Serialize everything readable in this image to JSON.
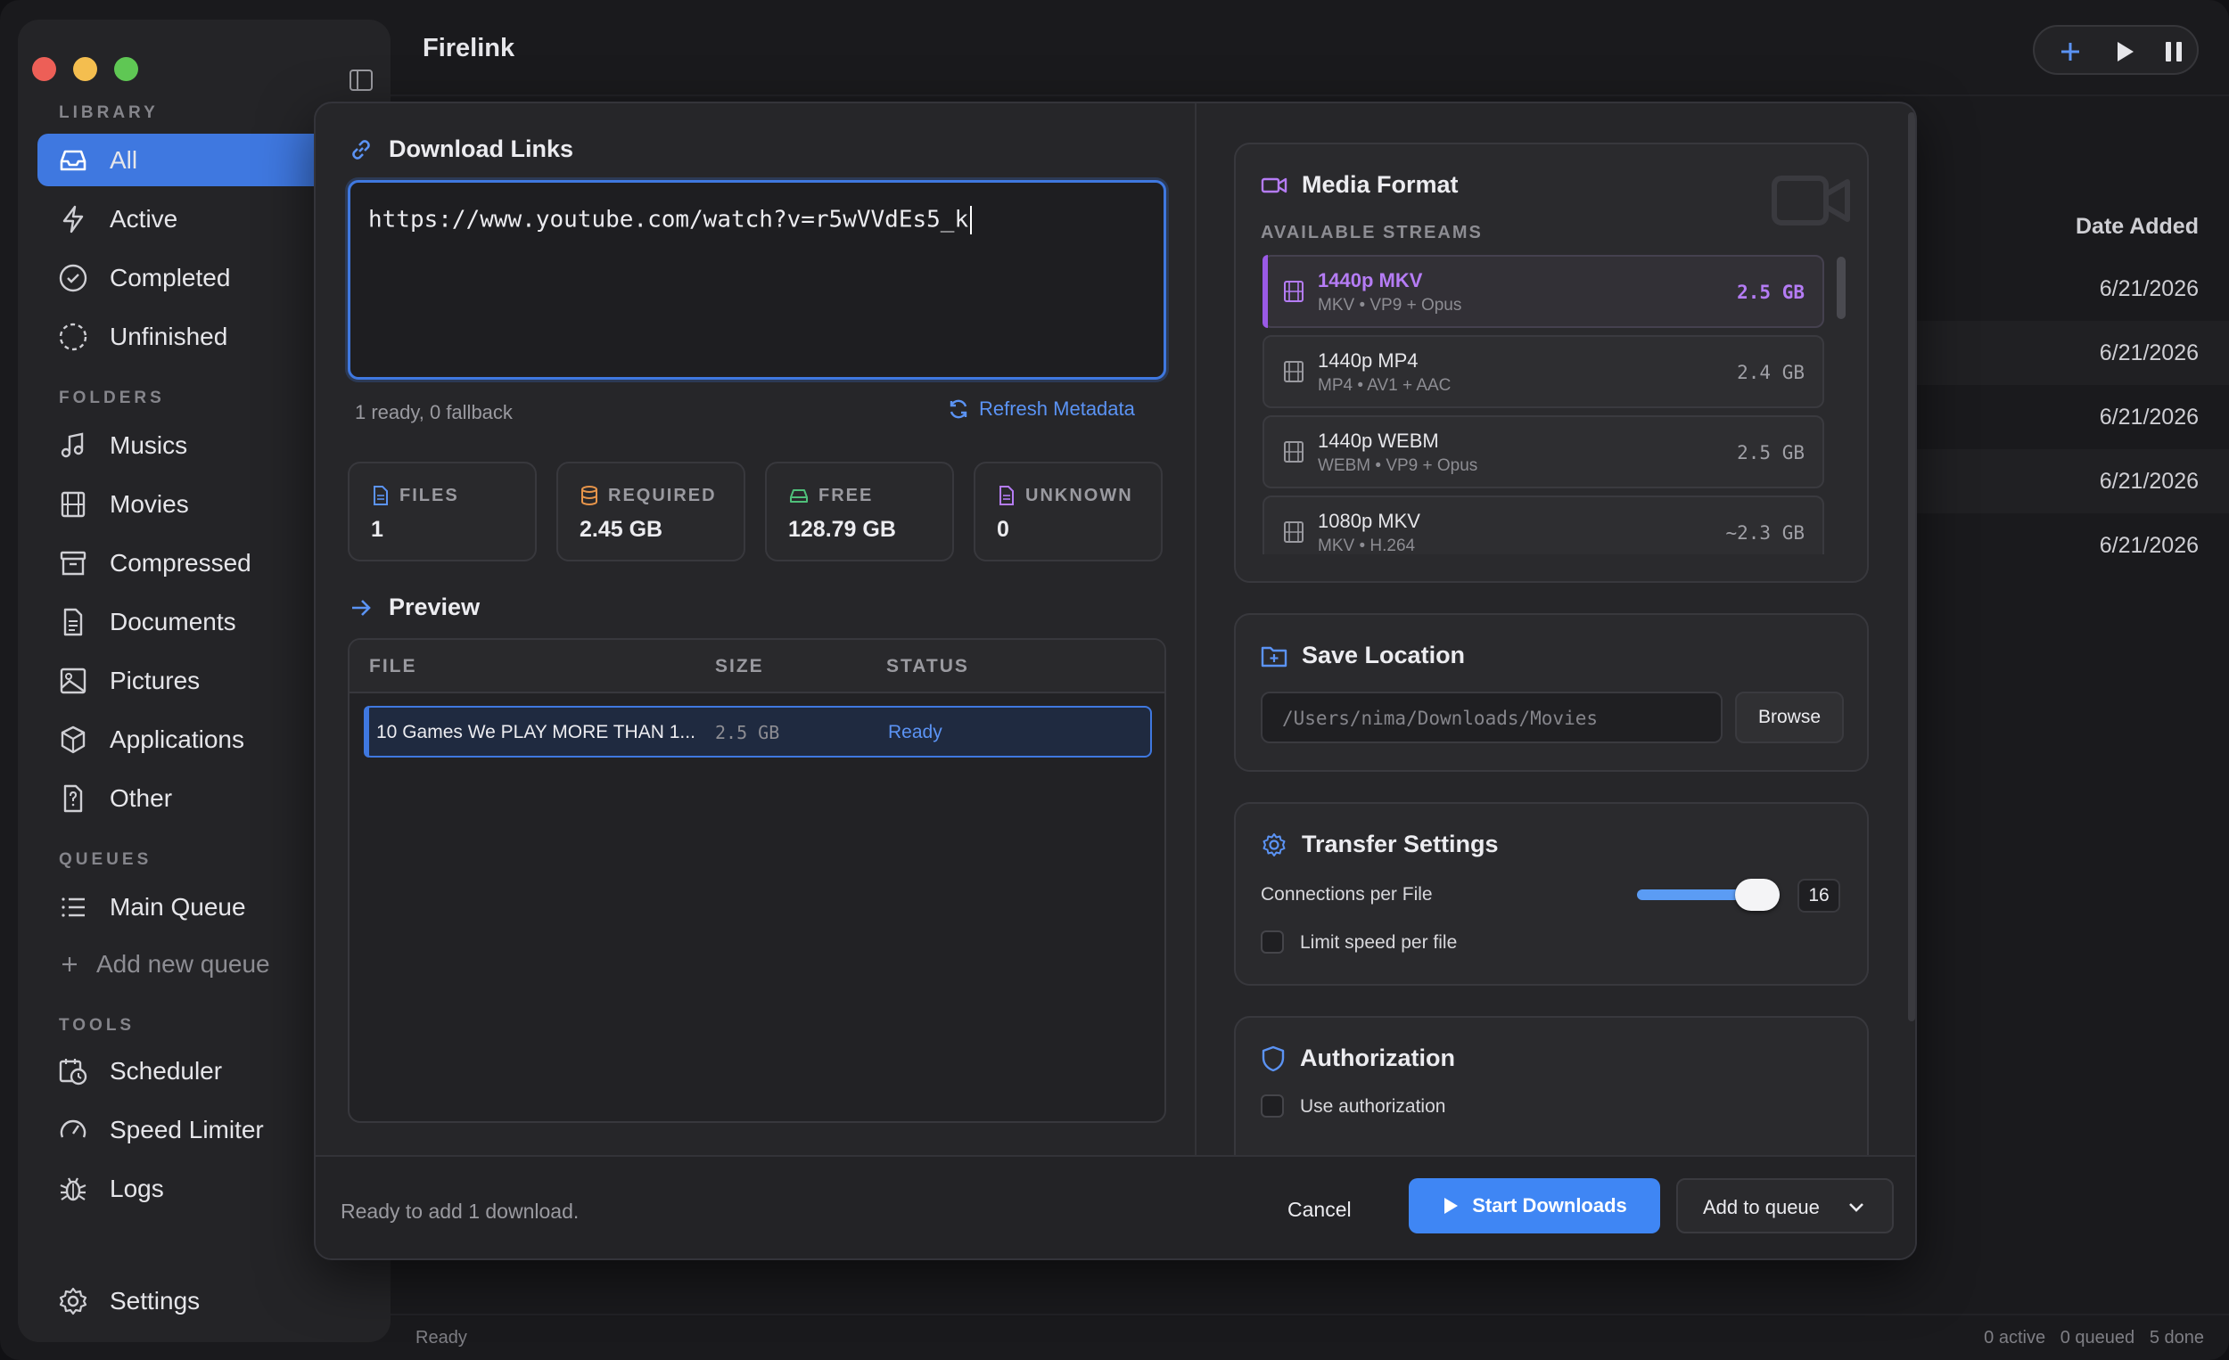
{
  "app": {
    "title": "Firelink"
  },
  "sidebar": {
    "sections": {
      "library": "LIBRARY",
      "folders": "FOLDERS",
      "queues": "QUEUES",
      "tools": "TOOLS"
    },
    "library": [
      {
        "label": "All",
        "icon": "inbox-icon",
        "active": true
      },
      {
        "label": "Active",
        "icon": "bolt-icon"
      },
      {
        "label": "Completed",
        "icon": "check-circle-icon"
      },
      {
        "label": "Unfinished",
        "icon": "dashed-circle-icon"
      }
    ],
    "folders": [
      {
        "label": "Musics",
        "icon": "music-note-icon"
      },
      {
        "label": "Movies",
        "icon": "film-icon"
      },
      {
        "label": "Compressed",
        "icon": "archive-icon"
      },
      {
        "label": "Documents",
        "icon": "document-icon"
      },
      {
        "label": "Pictures",
        "icon": "image-icon"
      },
      {
        "label": "Applications",
        "icon": "cube-icon"
      },
      {
        "label": "Other",
        "icon": "question-file-icon"
      }
    ],
    "queues": [
      {
        "label": "Main Queue",
        "icon": "list-icon"
      }
    ],
    "add_queue": "Add new queue",
    "tools": [
      {
        "label": "Scheduler",
        "icon": "calendar-clock-icon"
      },
      {
        "label": "Speed Limiter",
        "icon": "gauge-icon"
      },
      {
        "label": "Logs",
        "icon": "bug-icon"
      }
    ],
    "settings": "Settings"
  },
  "background_table": {
    "date_header": "Date Added",
    "dates": [
      "6/21/2026",
      "6/21/2026",
      "6/21/2026",
      "6/21/2026",
      "6/21/2026"
    ]
  },
  "statusbar": {
    "left": "Ready",
    "right": "0 active   0 queued   5 done"
  },
  "modal": {
    "download_links": {
      "title": "Download Links",
      "url": "https://www.youtube.com/watch?v=r5wVVdEs5_k",
      "meta_status": "1 ready, 0 fallback",
      "refresh": "Refresh Metadata"
    },
    "stats": [
      {
        "label": "FILES",
        "value": "1",
        "icon": "file-icon",
        "color": "#5b93f4"
      },
      {
        "label": "REQUIRED",
        "value": "2.45 GB",
        "icon": "database-icon",
        "color": "#e8954a"
      },
      {
        "label": "FREE",
        "value": "128.79 GB",
        "icon": "drive-icon",
        "color": "#4fc07a"
      },
      {
        "label": "UNKNOWN",
        "value": "0",
        "icon": "file-icon",
        "color": "#b57cf5"
      }
    ],
    "preview": {
      "title": "Preview",
      "columns": [
        "FILE",
        "SIZE",
        "STATUS"
      ],
      "rows": [
        {
          "file": "10 Games We PLAY MORE THAN 1...",
          "size": "2.5 GB",
          "status": "Ready"
        }
      ]
    },
    "media_format": {
      "title": "Media Format",
      "subtitle": "AVAILABLE STREAMS",
      "streams": [
        {
          "name": "1440p MKV",
          "detail": "MKV • VP9 + Opus",
          "size": "2.5 GB",
          "selected": true
        },
        {
          "name": "1440p MP4",
          "detail": "MP4 • AV1 + AAC",
          "size": "2.4 GB"
        },
        {
          "name": "1440p WEBM",
          "detail": "WEBM • VP9 + Opus",
          "size": "2.5 GB"
        },
        {
          "name": "1080p MKV",
          "detail": "MKV • H.264",
          "size": "~2.3 GB"
        }
      ]
    },
    "save_location": {
      "title": "Save Location",
      "path": "/Users/nima/Downloads/Movies",
      "browse": "Browse"
    },
    "transfer": {
      "title": "Transfer Settings",
      "connections_label": "Connections per File",
      "connections_value": "16",
      "limit_label": "Limit speed per file"
    },
    "authorization": {
      "title": "Authorization",
      "use_label": "Use authorization"
    },
    "footer": {
      "message": "Ready to add 1 download.",
      "cancel": "Cancel",
      "start": "Start Downloads",
      "add_to_queue": "Add to queue"
    }
  },
  "colors": {
    "accent": "#3f78e0",
    "primary_button": "#3f86f4",
    "selected_stream": "#9a5ae6"
  }
}
